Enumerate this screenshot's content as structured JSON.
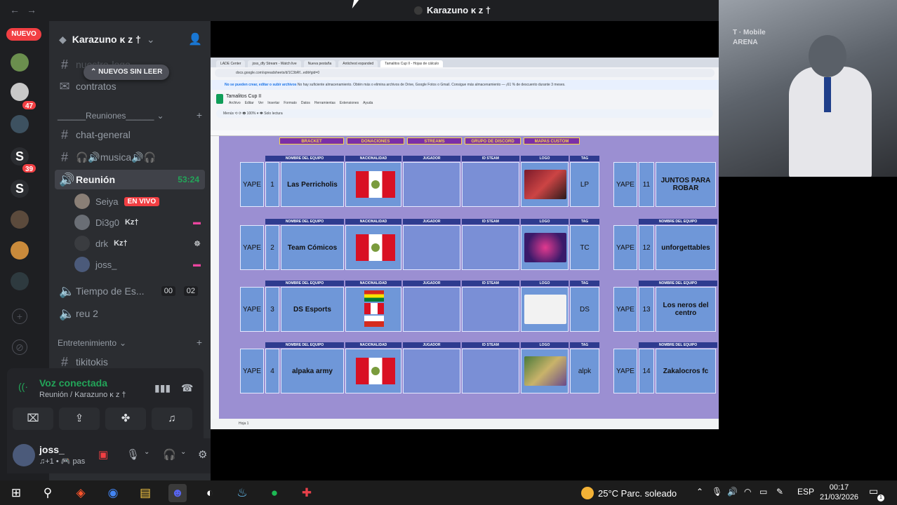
{
  "window": {
    "title": "Karazuno ᴋ ᴢ †",
    "back": "←",
    "forward": "→"
  },
  "rail": {
    "nuevo": "NUEVO",
    "badges": [
      "47",
      "39"
    ],
    "add": "+",
    "explore": "⊘"
  },
  "server": {
    "name": "Karazuno ᴋ ᴢ †",
    "pill": "⌃ NUEVOS SIN LEER"
  },
  "channels": {
    "hidden_top": "nuestro-logo",
    "contratos": "contratos",
    "reuniones_cat": "______Reuniones______",
    "chat_general": "chat-general",
    "musica": "🎧🔊musica🔊🎧",
    "reunion": "Reunión",
    "reunion_time": "53:24",
    "tiempo": "Tiempo de Es...",
    "tiempo_counts": [
      "00",
      "02"
    ],
    "reu2": "reu 2",
    "entretenimiento_cat": "Entretenimiento",
    "tikitokis": "tikitokis"
  },
  "voice_users": [
    {
      "name": "Seiya",
      "live": "EN VIVO"
    },
    {
      "name": "Di3g0",
      "tag": "Kz†"
    },
    {
      "name": "drk",
      "tag": "Kz†"
    },
    {
      "name": "joss_"
    }
  ],
  "voice_panel": {
    "title": "Voz conectada",
    "subtitle": "Reunión / Karazuno ᴋ ᴢ †"
  },
  "user": {
    "name": "joss_",
    "status": "♫+1 • 🎮 pas"
  },
  "browser": {
    "tabs": [
      "LADE Center",
      "joss_dfy Stream - Watch live",
      "Nueva pestaña",
      "Antichest expanded",
      "Tamalitos Cup II - Hojas de cálculo"
    ],
    "url": "docs.google.com/spreadsheets/d/1C3bRf...edit#gid=0",
    "warning": "No se pueden crear, editar o subir archivos",
    "warning_rest": " No hay suficiente almacenamiento. Obtén más o elimina archivos de Drive, Google Fotos o Gmail. Consigue más almacenamiento — ¡61 % de descuento durante 3 meses.",
    "sheet_title": "Tamalitos Cup II",
    "menu": [
      "Archivo",
      "Editar",
      "Ver",
      "Insertar",
      "Formato",
      "Datos",
      "Herramientas",
      "Extensiones",
      "Ayuda"
    ],
    "toolbar": "Menús   ⟲ ⟳ 🖶   100%   ▾   👁 Solo lectura",
    "sheet_tab": "Hoja 1"
  },
  "sheet_header": [
    "BRACKET",
    "DONACIONES",
    "STREAMS",
    "GRUPO DE DISCORD",
    "MAPAS CUSTOM"
  ],
  "team_cols": [
    "NOMBRE DEL EQUIPO",
    "NACIONALIDAD",
    "JUGADOR",
    "ID STEAM",
    "LOGO",
    "TAG"
  ],
  "teams_left": [
    {
      "yape": "YAPE",
      "num": "1",
      "name": "Las Perricholis",
      "tag": "LP"
    },
    {
      "yape": "YAPE",
      "num": "2",
      "name": "Team Cómicos",
      "tag": "TC"
    },
    {
      "yape": "YAPE",
      "num": "3",
      "name": "DS Esports",
      "tag": "DS"
    },
    {
      "yape": "YAPE",
      "num": "4",
      "name": "alpaka army",
      "tag": "alpk"
    }
  ],
  "teams_right": [
    {
      "yape": "YAPE",
      "num": "11",
      "name": "JUNTOS PARA ROBAR"
    },
    {
      "yape": "YAPE",
      "num": "12",
      "name": "unforgettables"
    },
    {
      "yape": "YAPE",
      "num": "13",
      "name": "Los neros del centro"
    },
    {
      "yape": "YAPE",
      "num": "14",
      "name": "Zakalocros fc"
    }
  ],
  "webcam": {
    "sign": "T · Mobile\nARENA"
  },
  "taskbar": {
    "weather": "25°C  Parc. soleado",
    "lang": "ESP",
    "time": "00:17",
    "date": "21/03/2026",
    "notif_count": "1"
  },
  "colors": {
    "accent_green": "#23a559",
    "red": "#f23f43",
    "sheet_purple": "#9b8fd2"
  }
}
